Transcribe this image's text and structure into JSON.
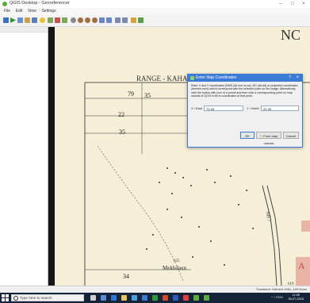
{
  "window": {
    "title": "QGIS Desktop - Georeferencer",
    "minimize": "–",
    "maximize": "□",
    "close": "×"
  },
  "menu": [
    "File",
    "Edit",
    "View",
    "Settings"
  ],
  "map": {
    "title": "RANGE - KAHANI & LAKHNADON",
    "corner_text": "NC",
    "grid_labels": [
      "79",
      "35",
      "22",
      "35",
      "34"
    ],
    "village_label": "Mekhdaun",
    "elev_labels": [
      "625",
      "619"
    ],
    "right_label": "NH 7",
    "edge_letter": "A"
  },
  "dialog": {
    "title": "Enter Map Coordinates",
    "help": "?",
    "close": "×",
    "message": "Enter X and Y coordinates (DMS (dd mm ss.ss), DD (dd.dd) or projected coordinates (mmmm.mm)) which correspond with the selected point on the image. Alternatively, click the button with icon of a pencil and then click a corresponding point on map canvas of QGIS to fill in coordinates of that point.",
    "x_label": "X / East",
    "x_value": "79.35",
    "y_label": "Y / North",
    "y_value": "22.35",
    "ok": "OK",
    "from_canvas": "From map canvas",
    "cancel": "Cancel"
  },
  "status": {
    "text": "Transform: Helmert   1961,-109   None"
  },
  "taskbar": {
    "search_placeholder": "Type here to search",
    "time": "11:08",
    "date": "05-07-2018",
    "tray": "^ ♪ ENG"
  }
}
